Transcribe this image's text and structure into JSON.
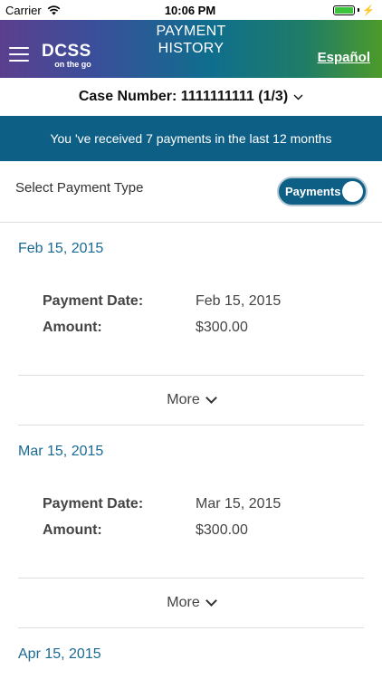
{
  "status": {
    "carrier": "Carrier",
    "time": "10:06 PM"
  },
  "header": {
    "title_line1": "PAYMENT",
    "title_line2": "HISTORY",
    "logo_main": "DCSS",
    "logo_sub": "on the go",
    "language": "Español"
  },
  "case": {
    "label": "Case Number: 1111111111 (1/3)"
  },
  "banner": {
    "text": "You 've received 7 payments in the last 12 months"
  },
  "select_type": {
    "label": "Select Payment Type",
    "toggle_label": "Payments"
  },
  "payments": [
    {
      "heading": "Feb 15, 2015",
      "date_label": "Payment Date:",
      "date_value": "Feb 15, 2015",
      "amount_label": "Amount:",
      "amount_value": "$300.00",
      "more": "More"
    },
    {
      "heading": "Mar 15, 2015",
      "date_label": "Payment Date:",
      "date_value": "Mar 15, 2015",
      "amount_label": "Amount:",
      "amount_value": "$300.00",
      "more": "More"
    },
    {
      "heading": "Apr 15, 2015"
    }
  ],
  "icons": {
    "wifi": "wifi-icon",
    "battery": "battery-icon",
    "menu": "hamburger-menu-icon",
    "chevron": "chevron-down-icon"
  },
  "colors": {
    "banner": "#0e5f86",
    "heading": "#1a6a93",
    "toggle": "#0e5f86"
  }
}
